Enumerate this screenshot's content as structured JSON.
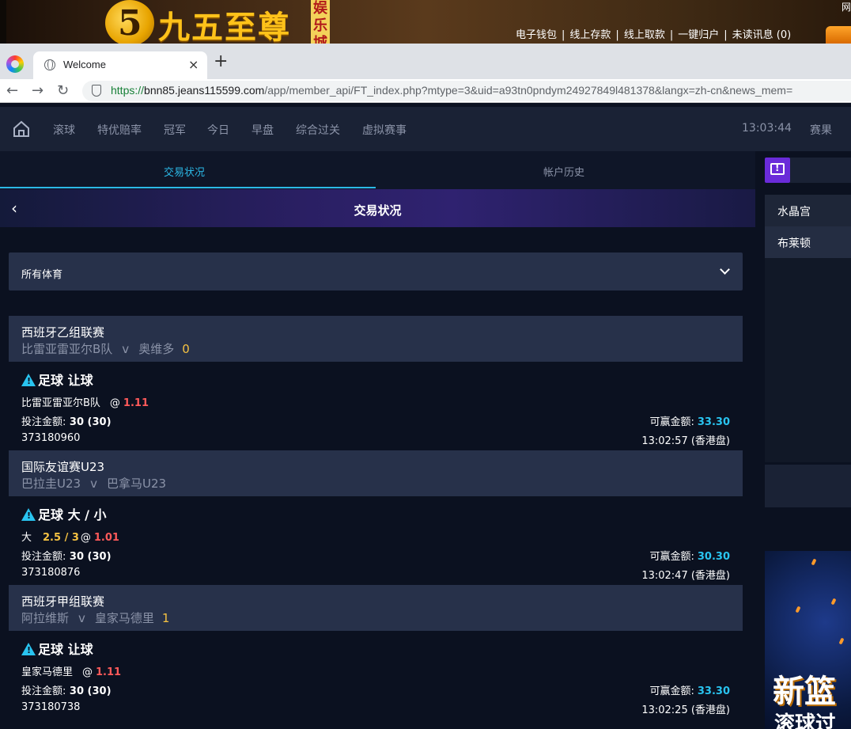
{
  "brand": {
    "logo_digit": "5",
    "logo_text": "九五至尊",
    "logo_tag": "娱乐城",
    "top_links": [
      "电子钱包",
      "线上存款",
      "线上取款",
      "一键归户",
      "未读讯息 (0)"
    ],
    "corner_text": "网"
  },
  "browser": {
    "tab_title": "Welcome",
    "tab_close": "×",
    "new_tab": "+",
    "url_scheme": "https://",
    "url_host": "bnn85.jeans115599.com",
    "url_path": "/app/member_api/FT_index.php?mtype=3&uid=a93tn0pndym24927849l481378&langx=zh-cn&news_mem="
  },
  "nav": {
    "items": [
      "滚球",
      "特优赔率",
      "冠军",
      "今日",
      "早盘",
      "综合过关",
      "虚拟赛事"
    ],
    "clock": "13:03:44",
    "results": "赛果"
  },
  "subtabs": {
    "active": "交易状况",
    "inactive": "帐户历史"
  },
  "page": {
    "title": "交易状况",
    "back": "‹"
  },
  "sport_filter": {
    "selected": "所有体育"
  },
  "bets": [
    {
      "league": "西班牙乙组联赛",
      "home": "比雷亚雷亚尔B队",
      "vs": "v",
      "away": "奥维多",
      "score": "0",
      "bet_type": "足球 让球",
      "selection": "比雷亚雷亚尔B队",
      "handicap": "",
      "at": "@",
      "odds": "1.11",
      "stake_label": "投注金额:",
      "stake": "30 (30)",
      "win_label": "可赢金额:",
      "win": "33.30",
      "ticket": "373180960",
      "time": "13:02:57 (香港盘)"
    },
    {
      "league": "国际友谊赛U23",
      "home": "巴拉圭U23",
      "vs": "v",
      "away": "巴拿马U23",
      "score": "",
      "bet_type": "足球 大 / 小",
      "selection": "大",
      "handicap": "2.5 / 3",
      "at": "@",
      "odds": "1.01",
      "stake_label": "投注金额:",
      "stake": "30 (30)",
      "win_label": "可赢金额:",
      "win": "30.30",
      "ticket": "373180876",
      "time": "13:02:47 (香港盘)"
    },
    {
      "league": "西班牙甲组联赛",
      "home": "阿拉维斯",
      "vs": "v",
      "away": "皇家马德里",
      "score": "1",
      "bet_type": "足球 让球",
      "selection": "皇家马德里",
      "handicap": "",
      "at": "@",
      "odds": "1.11",
      "stake_label": "投注金额:",
      "stake": "30 (30)",
      "win_label": "可赢金额:",
      "win": "33.30",
      "ticket": "373180738",
      "time": "13:02:25 (香港盘)"
    }
  ],
  "right_panel": {
    "items": [
      "水晶宫",
      "布莱顿"
    ],
    "promo_line1": "新篮",
    "promo_line2": "滚球过"
  },
  "colors": {
    "accent": "#2bb8e6",
    "odds": "#ff5a5a",
    "handicap": "#f5c242",
    "panel": "#27314a",
    "background": "#0b1120"
  }
}
